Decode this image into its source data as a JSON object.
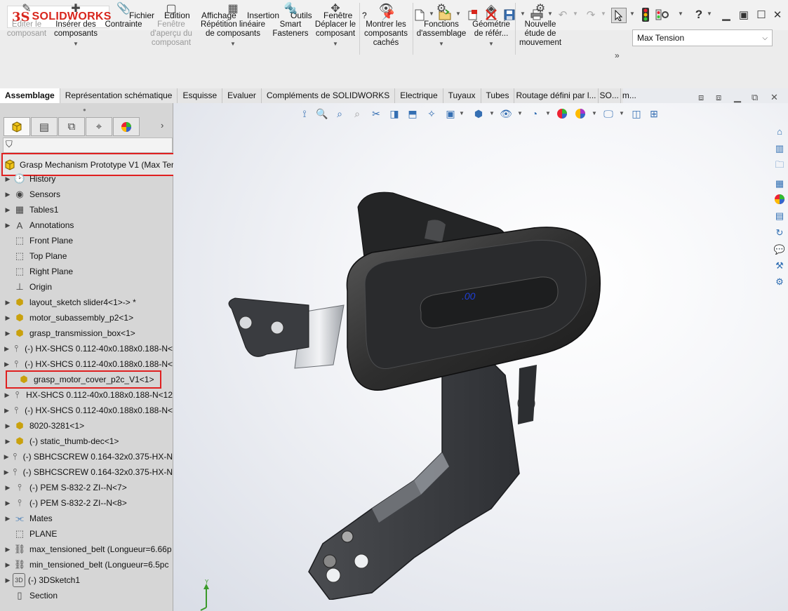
{
  "app": {
    "brand_mark": "3S",
    "brand_name": "SOLIDWORKS"
  },
  "menu": [
    "Fichier",
    "Edition",
    "Affichage",
    "Insertion",
    "Outils",
    "Fenêtre",
    "?"
  ],
  "toolbar_icons": [
    "new-icon",
    "open-icon",
    "print-preview-icon",
    "close-icon",
    "save-icon",
    "print-icon",
    "undo-icon",
    "redo-icon",
    "select-icon",
    "traffic-light-icon",
    "options-icon",
    "help-icon"
  ],
  "quick_toolbar": {
    "help_label": "?"
  },
  "commands": [
    {
      "label": "Editer le composant",
      "disabled": true
    },
    {
      "label": "Insérer des composants",
      "disabled": false
    },
    {
      "label": "Contrainte",
      "disabled": false
    },
    {
      "label": "Fenêtre d'aperçu du composant",
      "disabled": true
    },
    {
      "label": "Répétition linéaire de composants",
      "disabled": false
    },
    {
      "label": "Smart Fasteners",
      "disabled": false
    },
    {
      "label": "Déplacer le composant",
      "disabled": false
    },
    {
      "label": "Montrer les composants cachés",
      "disabled": false
    },
    {
      "label": "Fonctions d'assemblage",
      "disabled": false
    },
    {
      "label": "Géométrie de référ...",
      "disabled": false
    },
    {
      "label": "Nouvelle étude de mouvement",
      "disabled": false
    }
  ],
  "configuration": {
    "selected": "Max Tension"
  },
  "tabs": [
    "Assemblage",
    "Représentation schématique",
    "Esquisse",
    "Evaluer",
    "Compléments de SOLIDWORKS",
    "Electrique",
    "Tuyaux",
    "Tubes",
    "Routage défini par l...",
    "SO...",
    "m..."
  ],
  "active_tab": "Assemblage",
  "tree": {
    "root": "Grasp Mechanism Prototype V1  (Max Ter",
    "items": [
      {
        "label": "History",
        "icon": "history-icon",
        "expandable": true
      },
      {
        "label": "Sensors",
        "icon": "sensor-icon",
        "expandable": true
      },
      {
        "label": "Tables1",
        "icon": "table-icon",
        "expandable": true
      },
      {
        "label": "Annotations",
        "icon": "annotation-icon",
        "expandable": true
      },
      {
        "label": "Front Plane",
        "icon": "plane-icon",
        "expandable": false
      },
      {
        "label": "Top Plane",
        "icon": "plane-icon",
        "expandable": false
      },
      {
        "label": "Right Plane",
        "icon": "plane-icon",
        "expandable": false
      },
      {
        "label": "Origin",
        "icon": "origin-icon",
        "expandable": false
      },
      {
        "label": "layout_sketch slider4<1>-> *",
        "icon": "part-icon",
        "expandable": true
      },
      {
        "label": "motor_subassembly_p2<1>",
        "icon": "part-icon",
        "expandable": true
      },
      {
        "label": "grasp_transmission_box<1>",
        "icon": "part-icon",
        "expandable": true
      },
      {
        "label": "(-) HX-SHCS 0.112-40x0.188x0.188-N<",
        "icon": "screw-icon",
        "expandable": true
      },
      {
        "label": "(-) HX-SHCS 0.112-40x0.188x0.188-N<",
        "icon": "screw-icon",
        "expandable": true
      },
      {
        "label": "grasp_motor_cover_p2c_V1<1>",
        "icon": "part-icon",
        "expandable": false,
        "highlight": true
      },
      {
        "label": "HX-SHCS 0.112-40x0.188x0.188-N<12",
        "icon": "screw-icon",
        "expandable": true
      },
      {
        "label": "(-) HX-SHCS 0.112-40x0.188x0.188-N<",
        "icon": "screw-icon",
        "expandable": true
      },
      {
        "label": "8020-3281<1>",
        "icon": "part-icon",
        "expandable": true
      },
      {
        "label": "(-) static_thumb-dec<1>",
        "icon": "part-icon",
        "expandable": true
      },
      {
        "label": "(-) SBHCSCREW 0.164-32x0.375-HX-N",
        "icon": "screw-icon",
        "expandable": true
      },
      {
        "label": "(-) SBHCSCREW 0.164-32x0.375-HX-N",
        "icon": "screw-icon",
        "expandable": true
      },
      {
        "label": "(-) PEM S-832-2 ZI--N<7>",
        "icon": "screw-icon",
        "expandable": true
      },
      {
        "label": "(-) PEM S-832-2 ZI--N<8>",
        "icon": "screw-icon",
        "expandable": true
      },
      {
        "label": "Mates",
        "icon": "mates-icon",
        "expandable": true
      },
      {
        "label": "PLANE",
        "icon": "plane-icon",
        "expandable": false
      },
      {
        "label": "max_tensioned_belt (Longueur=6.66p",
        "icon": "belt-icon",
        "expandable": true
      },
      {
        "label": "min_tensioned_belt (Longueur=6.5pc",
        "icon": "belt-icon",
        "expandable": true
      },
      {
        "label": "(-) 3DSketch1",
        "icon": "sketch3d-icon",
        "expandable": true
      },
      {
        "label": "Section",
        "icon": "section-icon",
        "expandable": false
      }
    ]
  },
  "viewport": {
    "dimension_text": ".00",
    "triad_label": "Y"
  }
}
